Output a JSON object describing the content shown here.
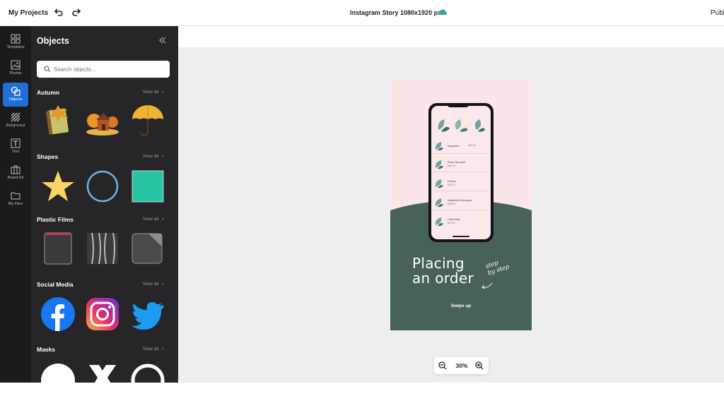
{
  "topbar": {
    "my_projects": "My Projects",
    "doc_title": "Instagram Story 1080x1920 px",
    "publish": "Publ"
  },
  "rail": {
    "items": [
      {
        "label": "Templates",
        "icon": "templates-icon"
      },
      {
        "label": "Photos",
        "icon": "photos-icon"
      },
      {
        "label": "Objects",
        "icon": "objects-icon",
        "active": true
      },
      {
        "label": "Bckground",
        "icon": "background-icon"
      },
      {
        "label": "Text",
        "icon": "text-icon"
      },
      {
        "label": "Brand Kit",
        "icon": "brand-kit-icon"
      },
      {
        "label": "My Files",
        "icon": "folder-icon"
      }
    ]
  },
  "panel": {
    "title": "Objects",
    "search_placeholder": "Search objects...",
    "view_all": "View all",
    "categories": [
      {
        "title": "Autumn",
        "items": [
          "book-leaf",
          "autumn-house",
          "umbrella"
        ]
      },
      {
        "title": "Shapes",
        "items": [
          "star",
          "circle-outline",
          "square"
        ]
      },
      {
        "title": "Plastic Films",
        "items": [
          "film-square",
          "film-wavy",
          "film-peel"
        ]
      },
      {
        "title": "Social Media",
        "items": [
          "facebook-logo",
          "instagram-logo",
          "twitter-logo"
        ]
      },
      {
        "title": "Masks",
        "items": [
          "circle-mask",
          "x-mask",
          "ring-mask"
        ]
      }
    ]
  },
  "canvas": {
    "headline_line1": "Placing",
    "headline_line2": "an order",
    "script_line1": "step",
    "script_line2": "by step",
    "swipe": "Swipe up",
    "phone_rows": [
      {
        "name": "Magnolia",
        "price": "$15.00"
      },
      {
        "name": "Rose Bouquet",
        "price": "$35.00"
      },
      {
        "name": "Protea",
        "price": "$10.00"
      },
      {
        "name": "Waterlilies Bouquet",
        "price": "$45.00"
      },
      {
        "name": "Calla lilies",
        "price": "$15.00"
      }
    ]
  },
  "zoom": {
    "level": "30%"
  },
  "colors": {
    "accent": "#1f6fd6",
    "story_green": "#46625a",
    "story_pink": "#fde6e7",
    "teal": "#26c6a5"
  }
}
